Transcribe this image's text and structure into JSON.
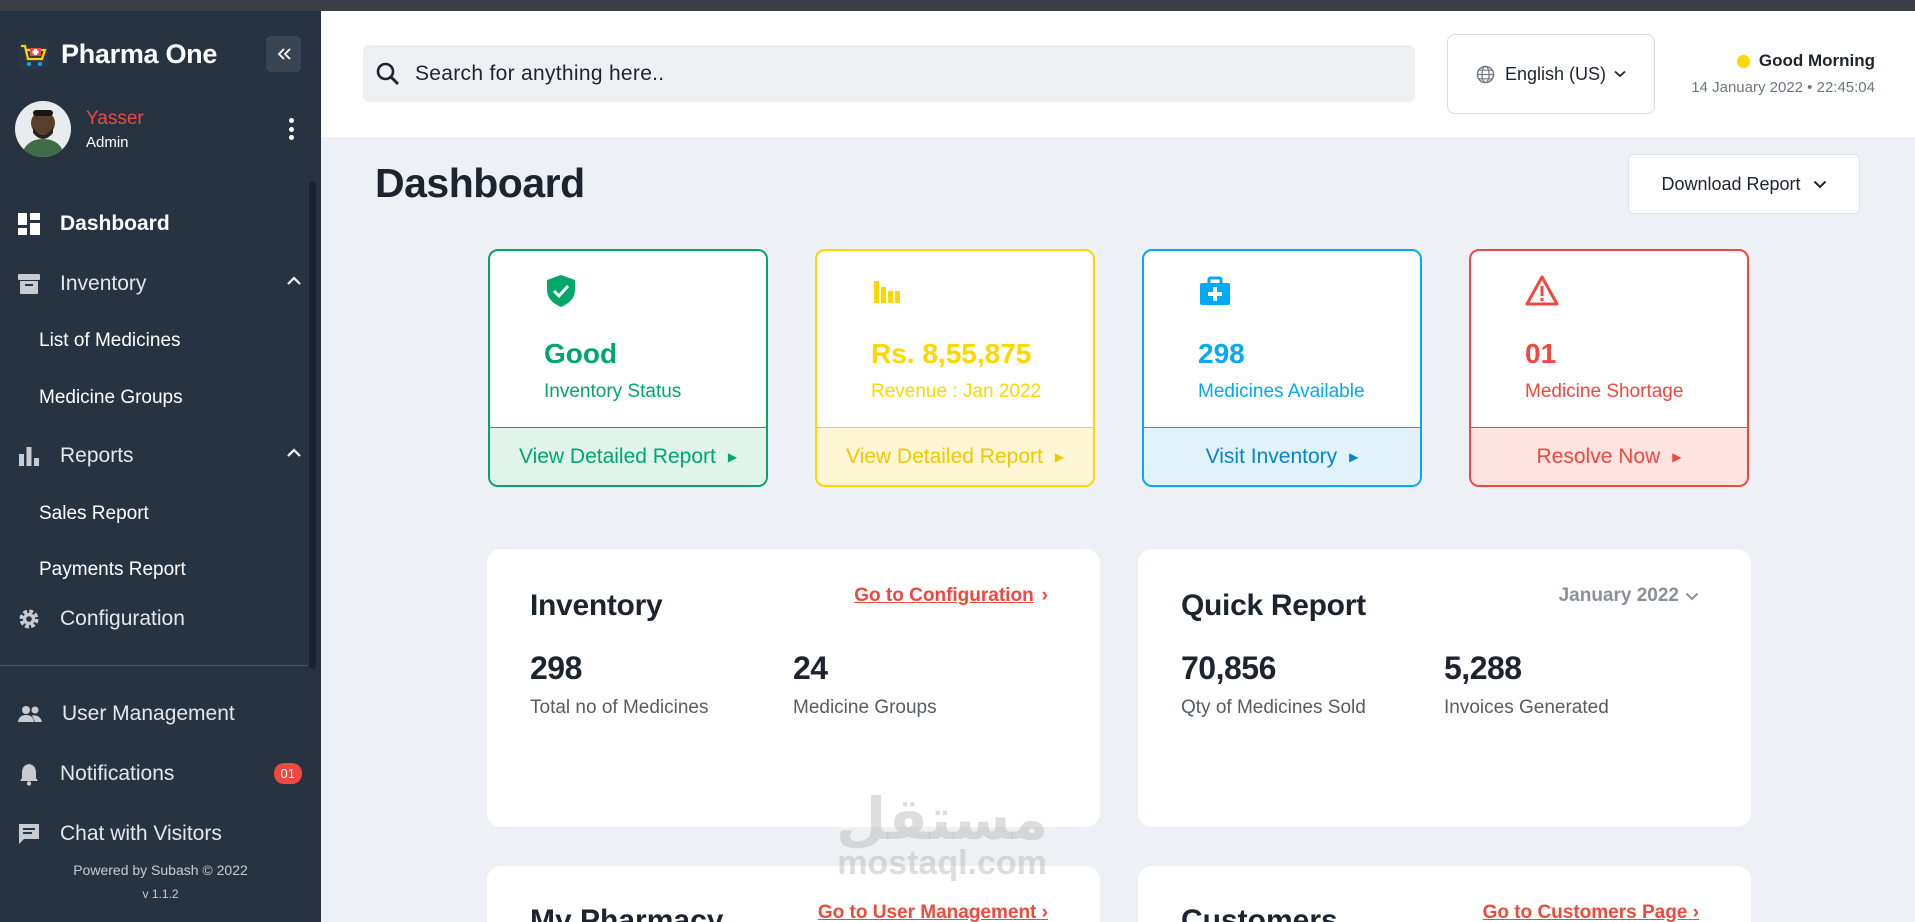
{
  "app": {
    "name": "Pharma One"
  },
  "user": {
    "name": "Yasser",
    "role": "Admin"
  },
  "nav": {
    "dashboard": "Dashboard",
    "inventory": "Inventory",
    "list_of_medicines": "List of Medicines",
    "medicine_groups": "Medicine Groups",
    "reports": "Reports",
    "sales_report": "Sales Report",
    "payments_report": "Payments Report",
    "configuration": "Configuration",
    "user_management": "User Management",
    "notifications": "Notifications",
    "notifications_count": "01",
    "chat": "Chat with Visitors"
  },
  "footer": {
    "powered": "Powered by Subash © 2022",
    "version": "v 1.1.2"
  },
  "header": {
    "search_placeholder": "Search for anything here..",
    "language": "English (US)",
    "greeting": "Good Morning",
    "datetime": "14 January 2022 • 22:45:04"
  },
  "page": {
    "title": "Dashboard",
    "download_label": "Download Report"
  },
  "cards": [
    {
      "value": "Good",
      "label": "Inventory Status",
      "action": "View Detailed Report",
      "color": "#01a768",
      "bg": "#e0f4ec"
    },
    {
      "value": "Rs. 8,55,875",
      "label": "Revenue : Jan 2022",
      "action": "View Detailed Report",
      "color": "#fed600",
      "bg": "#fff6d6"
    },
    {
      "value": "298",
      "label": "Medicines Available",
      "action": "Visit Inventory",
      "color": "#03a9f5",
      "bg": "#e2f2fb"
    },
    {
      "value": "01",
      "label": "Medicine Shortage",
      "action": "Resolve Now",
      "color": "#f0483e",
      "bg": "#fde4e2"
    }
  ],
  "inventory_panel": {
    "title": "Inventory",
    "link": "Go to Configuration",
    "stats": [
      {
        "value": "298",
        "label": "Total no of Medicines"
      },
      {
        "value": "24",
        "label": "Medicine Groups"
      }
    ]
  },
  "quick_report": {
    "title": "Quick Report",
    "period": "January 2022",
    "stats": [
      {
        "value": "70,856",
        "label": "Qty of Medicines Sold"
      },
      {
        "value": "5,288",
        "label": "Invoices Generated"
      }
    ]
  },
  "bottom_panels": [
    {
      "title": "My Pharmacy",
      "link": "Go to User Management"
    },
    {
      "title": "Customers",
      "link": "Go to Customers Page"
    }
  ],
  "watermark": {
    "arabic": "مستقل",
    "latin": "mostaql.com"
  }
}
